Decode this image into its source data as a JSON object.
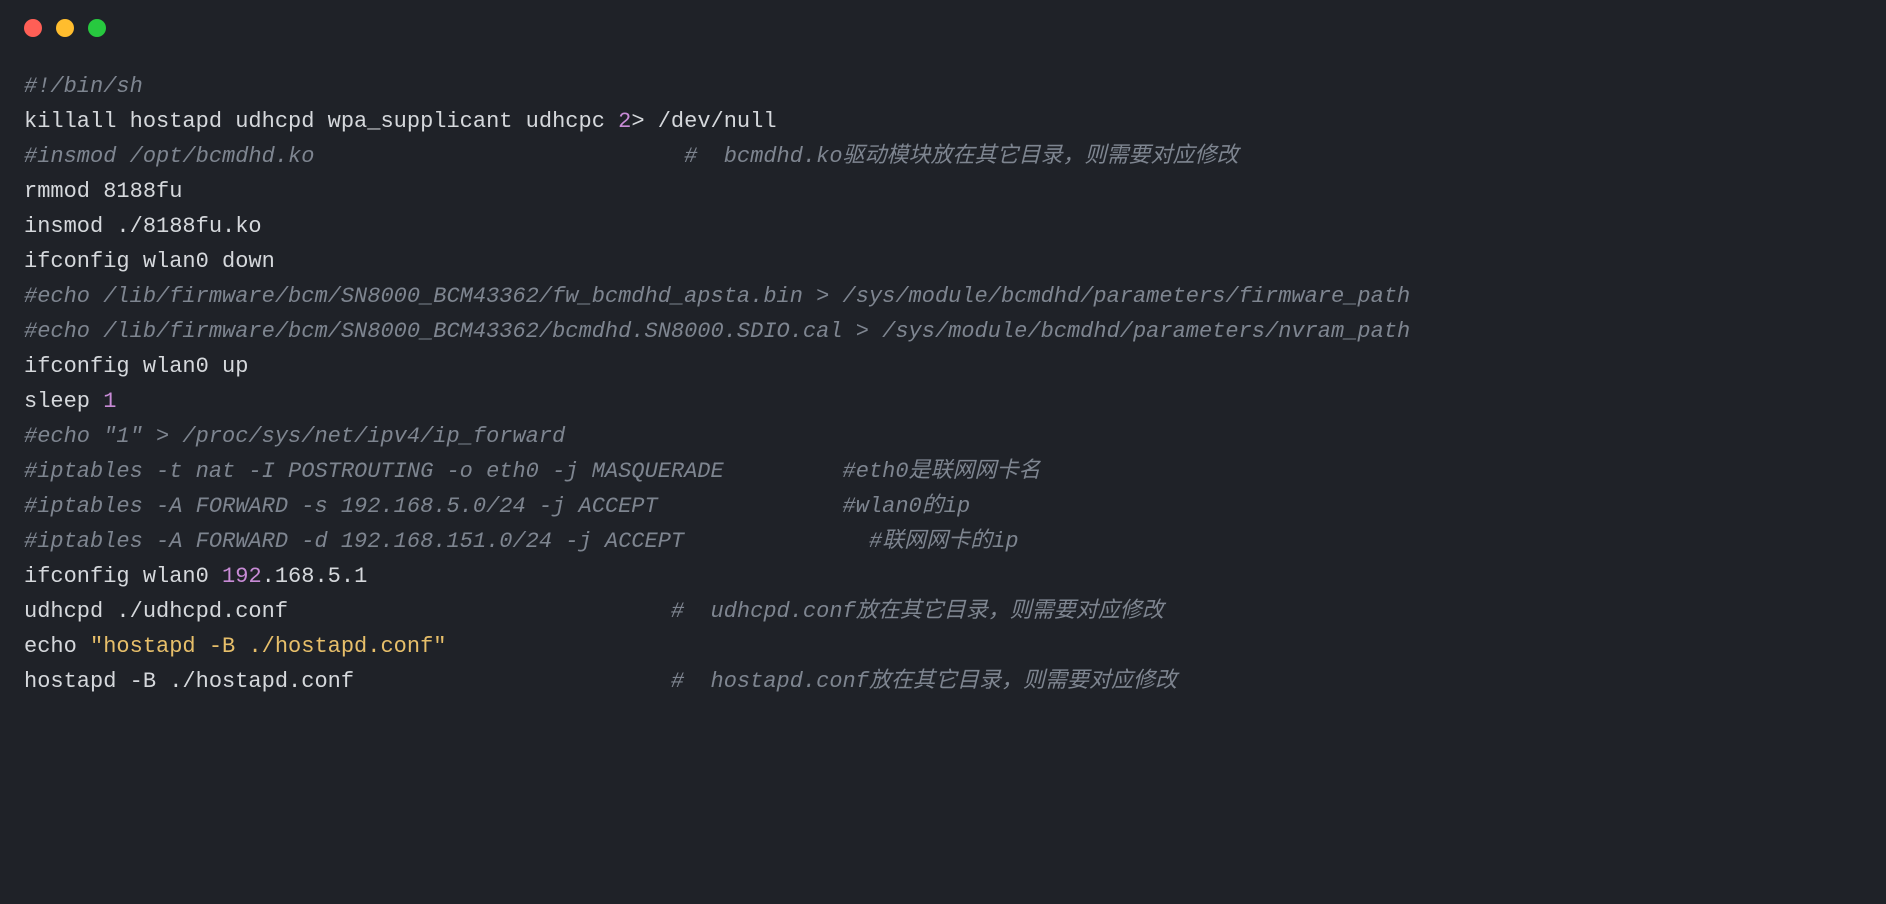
{
  "window": {
    "kind": "macos-terminal-code-preview"
  },
  "code": {
    "lines": [
      {
        "segments": [
          {
            "cls": "c-comment",
            "text": "#!/bin/sh"
          }
        ]
      },
      {
        "segments": [
          {
            "cls": "",
            "text": "killall hostapd udhcpd wpa_supplicant udhcpc "
          },
          {
            "cls": "c-number",
            "text": "2"
          },
          {
            "cls": "",
            "text": "> /dev/null"
          }
        ]
      },
      {
        "segments": [
          {
            "cls": "c-comment",
            "text": "#insmod /opt/bcmdhd.ko                            #  bcmdhd.ko驱动模块放在其它目录，则需要对应修改"
          }
        ]
      },
      {
        "segments": [
          {
            "cls": "",
            "text": "rmmod 8188fu"
          }
        ]
      },
      {
        "segments": [
          {
            "cls": "",
            "text": "insmod ./8188fu.ko"
          }
        ]
      },
      {
        "segments": [
          {
            "cls": "",
            "text": "ifconfig wlan0 down"
          }
        ]
      },
      {
        "segments": [
          {
            "cls": "c-comment",
            "text": "#echo /lib/firmware/bcm/SN8000_BCM43362/fw_bcmdhd_apsta.bin > /sys/module/bcmdhd/parameters/firmware_path"
          }
        ]
      },
      {
        "segments": [
          {
            "cls": "c-comment",
            "text": "#echo /lib/firmware/bcm/SN8000_BCM43362/bcmdhd.SN8000.SDIO.cal > /sys/module/bcmdhd/parameters/nvram_path"
          }
        ]
      },
      {
        "segments": [
          {
            "cls": "",
            "text": "ifconfig wlan0 up"
          }
        ]
      },
      {
        "segments": [
          {
            "cls": "",
            "text": "sleep "
          },
          {
            "cls": "c-number",
            "text": "1"
          }
        ]
      },
      {
        "segments": [
          {
            "cls": "c-comment",
            "text": "#echo \"1\" > /proc/sys/net/ipv4/ip_forward"
          }
        ]
      },
      {
        "segments": [
          {
            "cls": "c-comment",
            "text": "#iptables -t nat -I POSTROUTING -o eth0 -j MASQUERADE         #eth0是联网网卡名"
          }
        ]
      },
      {
        "segments": [
          {
            "cls": "c-comment",
            "text": "#iptables -A FORWARD -s 192.168.5.0/24 -j ACCEPT              #wlan0的ip"
          }
        ]
      },
      {
        "segments": [
          {
            "cls": "c-comment",
            "text": "#iptables -A FORWARD -d 192.168.151.0/24 -j ACCEPT              #联网网卡的ip"
          }
        ]
      },
      {
        "segments": [
          {
            "cls": "",
            "text": "ifconfig wlan0 "
          },
          {
            "cls": "c-number",
            "text": "192"
          },
          {
            "cls": "",
            "text": ".168.5.1"
          }
        ]
      },
      {
        "segments": [
          {
            "cls": "",
            "text": "udhcpd ./udhcpd.conf                             "
          },
          {
            "cls": "c-comment",
            "text": "#  udhcpd.conf放在其它目录，则需要对应修改"
          }
        ]
      },
      {
        "segments": [
          {
            "cls": "",
            "text": "echo "
          },
          {
            "cls": "c-string",
            "text": "\"hostapd -B ./hostapd.conf\""
          }
        ]
      },
      {
        "segments": [
          {
            "cls": "",
            "text": "hostapd -B ./hostapd.conf                        "
          },
          {
            "cls": "c-comment",
            "text": "#  hostapd.conf放在其它目录，则需要对应修改"
          }
        ]
      }
    ]
  }
}
